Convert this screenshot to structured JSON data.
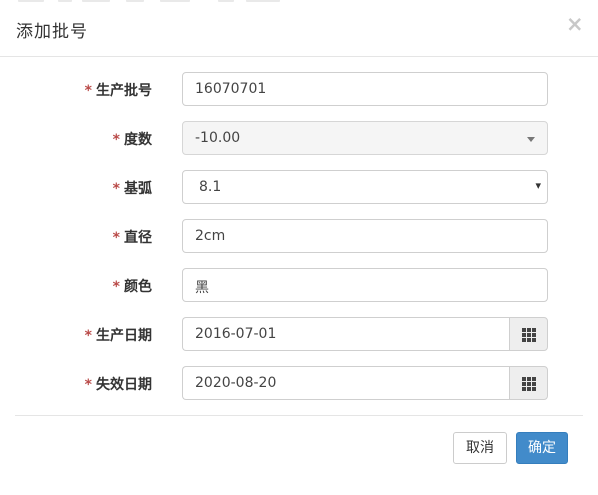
{
  "dialog": {
    "title": "添加批号",
    "close_symbol": "×"
  },
  "required_mark": "*",
  "fields": {
    "batch_no": {
      "label": "生产批号",
      "value": "16070701"
    },
    "degree": {
      "label": "度数",
      "value": "-10.00"
    },
    "base_curve": {
      "label": "基弧",
      "value": "8.1"
    },
    "diameter": {
      "label": "直径",
      "value": "2cm"
    },
    "color": {
      "label": "颜色",
      "value": "黑"
    },
    "production_date": {
      "label": "生产日期",
      "value": "2016-07-01"
    },
    "expiry_date": {
      "label": "失效日期",
      "value": "2020-08-20"
    }
  },
  "icons": {
    "select_arrow": "▾",
    "calendar": "grid-calendar-icon"
  },
  "footer": {
    "cancel_label": "取消",
    "confirm_label": "确定"
  },
  "colors": {
    "required": "#b94a48",
    "primary_button": "#428bca",
    "addon_background": "#eeeeee",
    "readonly_background": "#f5f5f5"
  }
}
